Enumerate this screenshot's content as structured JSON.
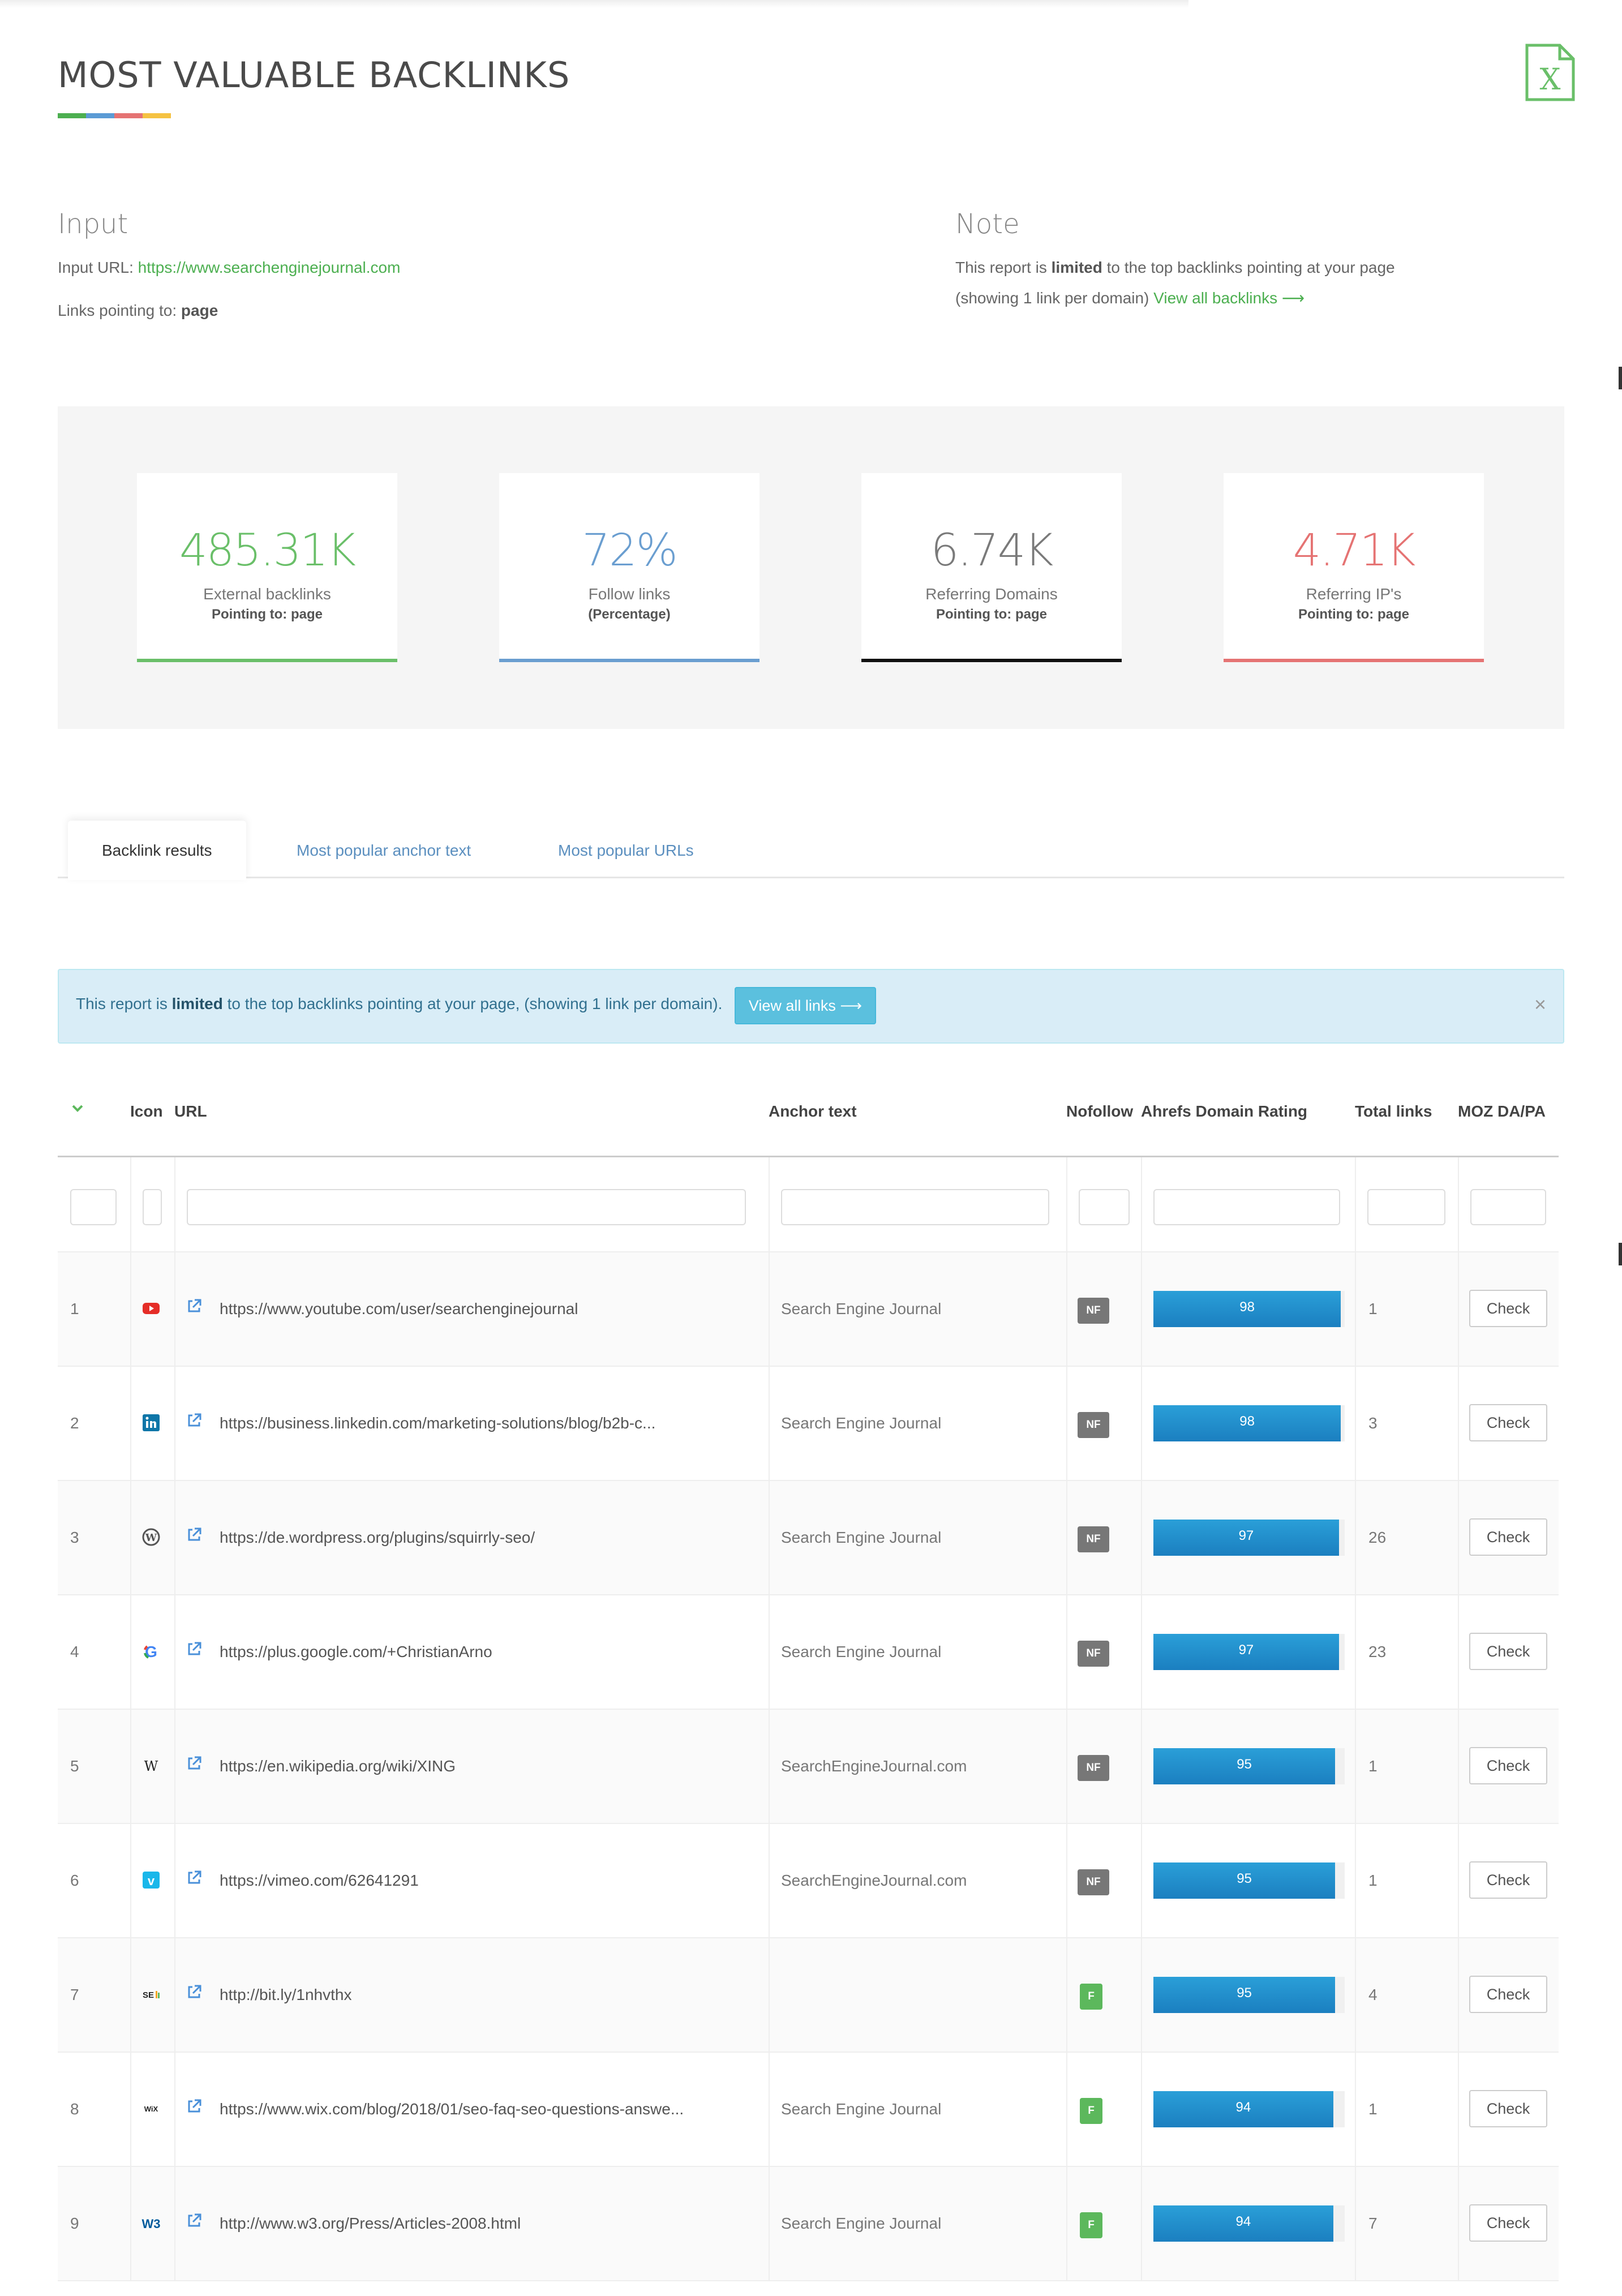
{
  "header": {
    "title": "MOST VALUABLE BACKLINKS",
    "underline_colors": [
      "#4caf50",
      "#5b9bd5",
      "#e57373",
      "#f5c242"
    ],
    "export_icon": "excel-icon"
  },
  "input": {
    "heading": "Input",
    "url_label": "Input URL:",
    "url_value": "https://www.searchenginejournal.com",
    "links_label": "Links pointing to:",
    "links_value": "page"
  },
  "note": {
    "heading": "Note",
    "line1_prefix": "This report is ",
    "line1_bold": "limited",
    "line1_suffix": " to the top backlinks pointing at your page",
    "line2_prefix": "(showing 1 link per domain) ",
    "line2_link": "View all backlinks ⟶"
  },
  "stats": [
    {
      "value": "485.31K",
      "label": "External backlinks",
      "sub": "Pointing to: page",
      "color": "#6abf69"
    },
    {
      "value": "72%",
      "label": "Follow links",
      "sub": "(Percentage)",
      "color": "#6a9ed0"
    },
    {
      "value": "6.74K",
      "label": "Referring Domains",
      "sub": "Pointing to: page",
      "color": "#7a7a7a",
      "bar_color": "#111111"
    },
    {
      "value": "4.71K",
      "label": "Referring IP's",
      "sub": "Pointing to: page",
      "color": "#e57373"
    }
  ],
  "tabs": [
    {
      "label": "Backlink results",
      "active": true
    },
    {
      "label": "Most popular anchor text",
      "active": false
    },
    {
      "label": "Most popular URLs",
      "active": false
    }
  ],
  "alert": {
    "prefix": "This report is ",
    "bold": "limited",
    "suffix": " to the top backlinks pointing at your page, (showing 1 link per domain).",
    "button": "View all links ⟶",
    "close": "×"
  },
  "table": {
    "columns": {
      "icon": "Icon",
      "url": "URL",
      "anchor": "Anchor text",
      "nofollow": "Nofollow",
      "dr": "Ahrefs Domain Rating",
      "total": "Total links",
      "moz": "MOZ DA/PA"
    },
    "rows": [
      {
        "n": "1",
        "icon": "youtube-icon",
        "url": "https://www.youtube.com/user/searchenginejournal",
        "anchor": "Search Engine Journal",
        "nf": "NF",
        "dr": 98,
        "total": "1",
        "check": "Check"
      },
      {
        "n": "2",
        "icon": "linkedin-icon",
        "url": "https://business.linkedin.com/marketing-solutions/blog/b2b-c...",
        "anchor": "Search Engine Journal",
        "nf": "NF",
        "dr": 98,
        "total": "3",
        "check": "Check"
      },
      {
        "n": "3",
        "icon": "wordpress-icon",
        "url": "https://de.wordpress.org/plugins/squirrly-seo/",
        "anchor": "Search Engine Journal",
        "nf": "NF",
        "dr": 97,
        "total": "26",
        "check": "Check"
      },
      {
        "n": "4",
        "icon": "google-icon",
        "url": "https://plus.google.com/+ChristianArno",
        "anchor": "Search Engine Journal",
        "nf": "NF",
        "dr": 97,
        "total": "23",
        "check": "Check"
      },
      {
        "n": "5",
        "icon": "wikipedia-icon",
        "url": "https://en.wikipedia.org/wiki/XING",
        "anchor": "SearchEngineJournal.com",
        "nf": "NF",
        "dr": 95,
        "total": "1",
        "check": "Check"
      },
      {
        "n": "6",
        "icon": "vimeo-icon",
        "url": "https://vimeo.com/62641291",
        "anchor": "SearchEngineJournal.com",
        "nf": "NF",
        "dr": 95,
        "total": "1",
        "check": "Check"
      },
      {
        "n": "7",
        "icon": "sej-icon",
        "url": "http://bit.ly/1nhvthx",
        "anchor": "",
        "nf": "F",
        "dr": 95,
        "total": "4",
        "check": "Check"
      },
      {
        "n": "8",
        "icon": "wix-icon",
        "url": "https://www.wix.com/blog/2018/01/seo-faq-seo-questions-answe...",
        "anchor": "Search Engine Journal",
        "nf": "F",
        "dr": 94,
        "total": "1",
        "check": "Check"
      },
      {
        "n": "9",
        "icon": "w3c-icon",
        "url": "http://www.w3.org/Press/Articles-2008.html",
        "anchor": "Search Engine Journal",
        "nf": "F",
        "dr": 94,
        "total": "7",
        "check": "Check"
      }
    ]
  }
}
